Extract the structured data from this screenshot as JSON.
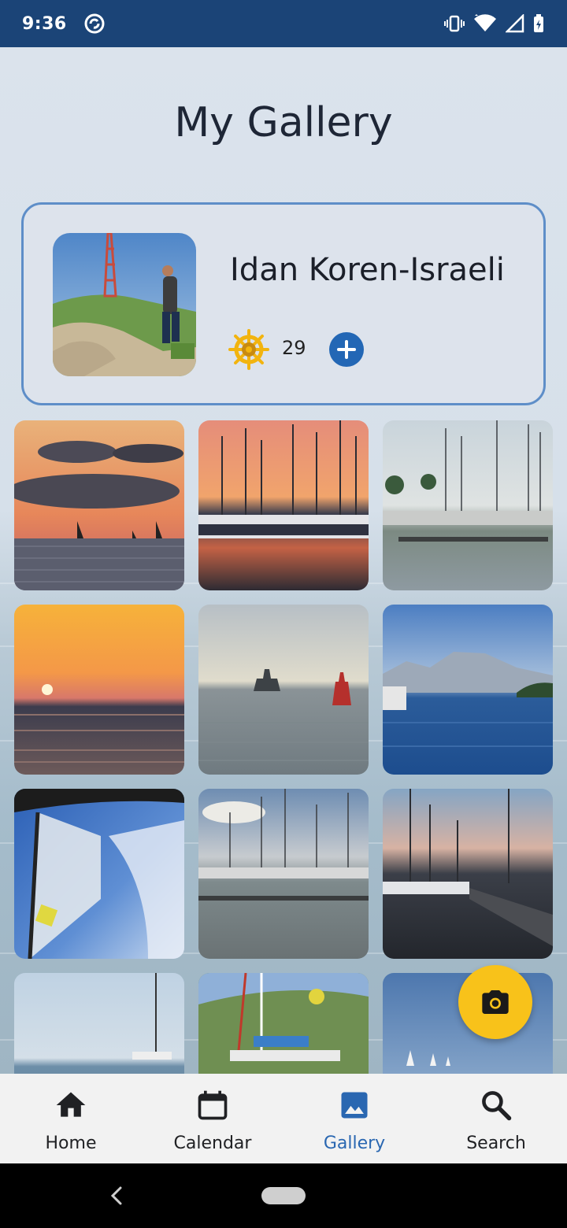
{
  "status_bar": {
    "time": "9:36",
    "app_icon": "sync-circle-icon",
    "right_icons": [
      "vibrate-icon",
      "wifi-icon",
      "signal-icon",
      "battery-icon"
    ]
  },
  "title": "My Gallery",
  "profile": {
    "name": "Idan Koren-Israeli",
    "points_icon": "ship-wheel-icon",
    "points": "29",
    "add_icon": "plus-icon"
  },
  "gallery": {
    "images": [
      "sunset-clouds-sailboats",
      "marina-sunset-reflection",
      "marina-palms-daytime",
      "sea-sunset-sun",
      "warship-and-buoy",
      "mountains-blue-sea",
      "sail-and-sky",
      "marina-pier-birds",
      "marina-dusk-dock",
      "coast-sailboat",
      "hillside-sailboat",
      "sailboats-distance"
    ]
  },
  "fab": {
    "icon": "camera-icon"
  },
  "bottom_nav": {
    "items": [
      {
        "label": "Home",
        "icon": "home-icon"
      },
      {
        "label": "Calendar",
        "icon": "calendar-icon"
      },
      {
        "label": "Gallery",
        "icon": "image-icon"
      },
      {
        "label": "Search",
        "icon": "search-icon"
      }
    ],
    "active_index": 2
  },
  "colors": {
    "status_bar": "#1b4477",
    "accent": "#2a67b1",
    "fab": "#f8c21a",
    "card_border": "#5e8ec8"
  }
}
